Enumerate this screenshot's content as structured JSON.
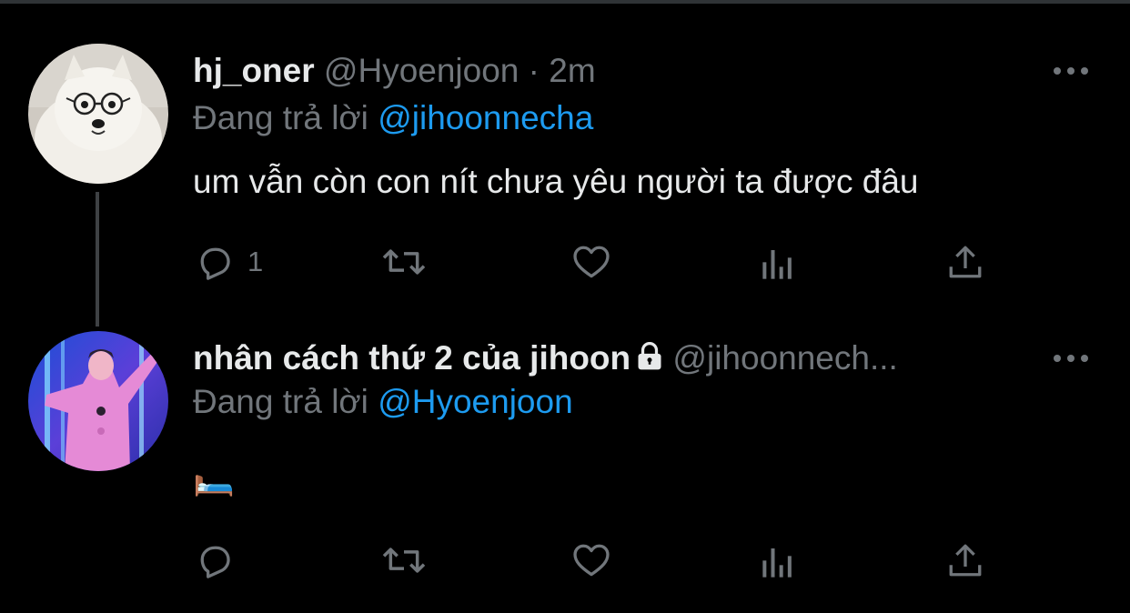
{
  "tweets": [
    {
      "display_name": "hj_oner",
      "handle": "@Hyoenjoon",
      "separator": "·",
      "time": "2m",
      "replying_prefix": "Đang trả lời",
      "replying_to": "@jihoonnecha",
      "text": "um vẫn còn con nít chưa yêu người ta được đâu",
      "reply_count": "1",
      "avatar": "samoyed-dog-with-glasses",
      "locked": false
    },
    {
      "display_name": "nhân cách thứ 2 của jihoon",
      "handle": "@jihoonnech...",
      "replying_prefix": "Đang trả lời",
      "replying_to": "@Hyoenjoon",
      "text": "🛏️",
      "reply_count": "",
      "avatar": "person-pink-neon-stage",
      "locked": true
    }
  ],
  "icons": {
    "reply": "reply-icon",
    "retweet": "retweet-icon",
    "like": "heart-icon",
    "analytics": "analytics-icon",
    "share": "share-icon",
    "more": "more-icon",
    "lock": "lock-icon"
  },
  "colors": {
    "background": "#000000",
    "text": "#e7e9ea",
    "muted": "#71767b",
    "mention": "#1d9bf0"
  }
}
